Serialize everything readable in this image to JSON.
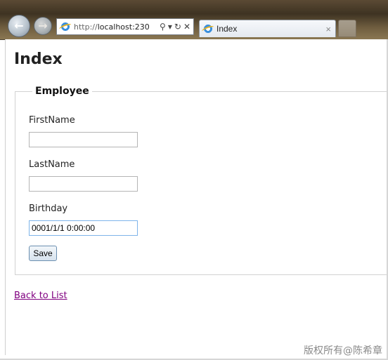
{
  "browser": {
    "back_glyph": "←",
    "forward_glyph": "→",
    "address_prefix": "http://",
    "address_host": "localhost:230",
    "address_icons": [
      "search-icon",
      "dropdown-arrow-icon",
      "refresh-icon",
      "stop-icon"
    ],
    "tab_title": "Index",
    "tab_close_glyph": "×"
  },
  "page": {
    "title": "Index",
    "legend": "Employee",
    "fields": {
      "first_name_label": "FirstName",
      "first_name_value": "",
      "last_name_label": "LastName",
      "last_name_value": "",
      "birthday_label": "Birthday",
      "birthday_value": "0001/1/1 0:00:00"
    },
    "save_label": "Save",
    "back_link": "Back to List"
  },
  "watermark": "版权所有@陈希章",
  "colors": {
    "visited_link": "#800080",
    "focus_border": "#7eb4ea"
  }
}
